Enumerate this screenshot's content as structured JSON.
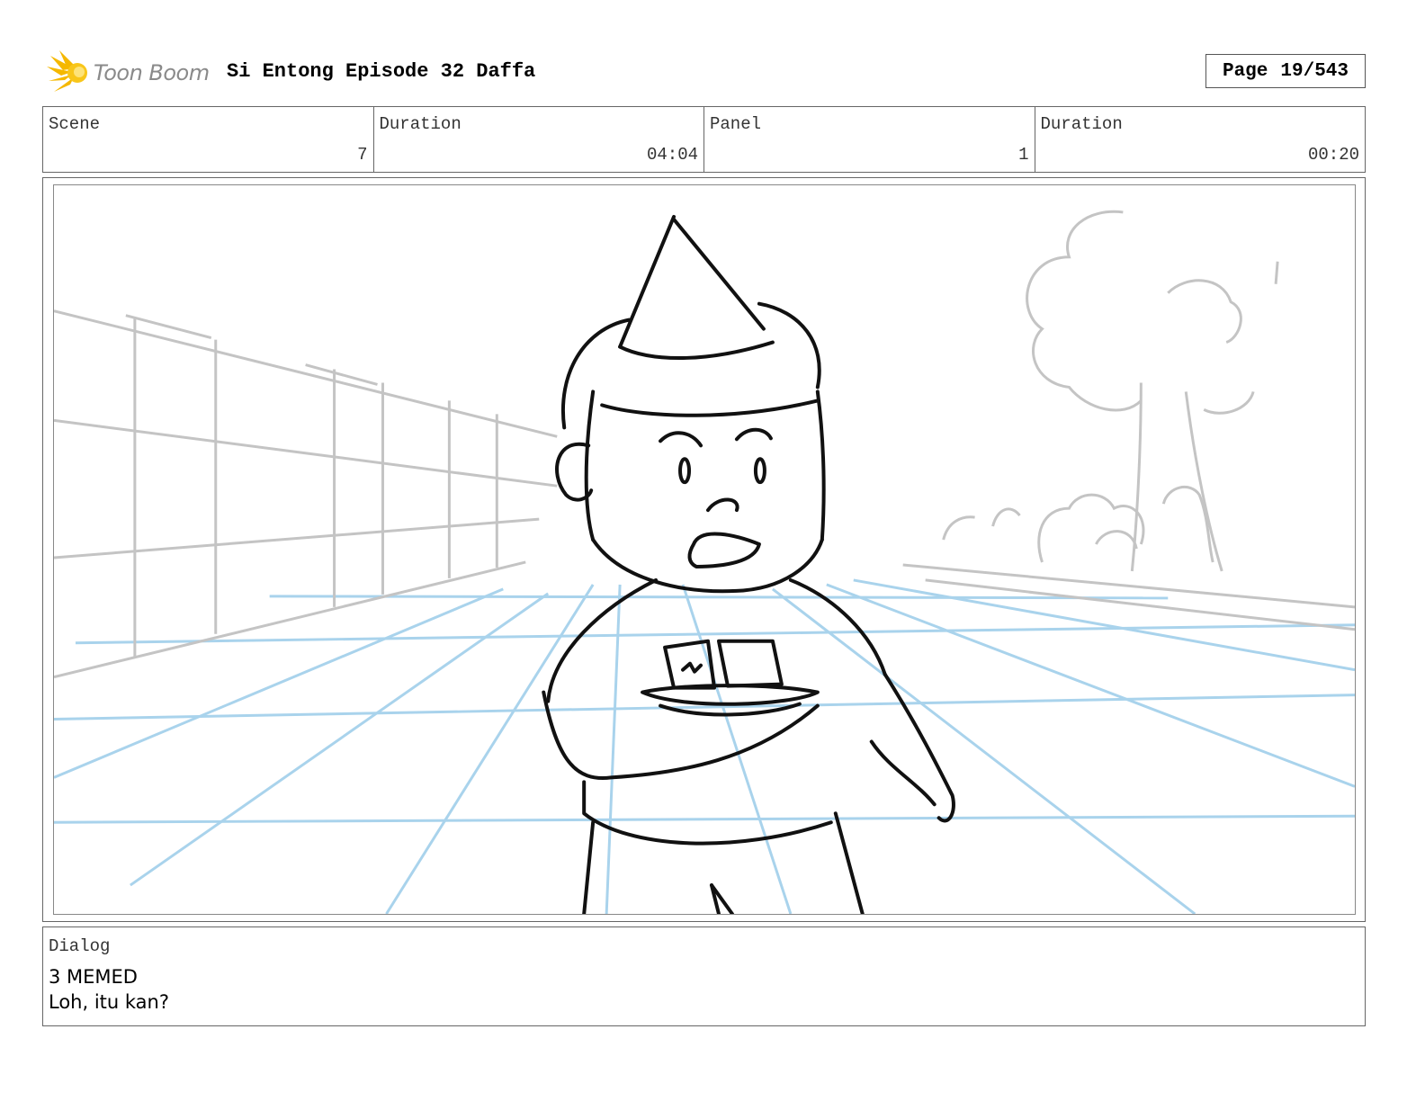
{
  "header": {
    "logo_text": "Toon Boom",
    "project_title": "Si Entong Episode 32 Daffa",
    "page_label": "Page",
    "page_value": "19/543"
  },
  "info": {
    "scene_label": "Scene",
    "scene_value": "7",
    "scene_duration_label": "Duration",
    "scene_duration_value": "04:04",
    "panel_label": "Panel",
    "panel_value": "1",
    "panel_duration_label": "Duration",
    "panel_duration_value": "00:20"
  },
  "dialog": {
    "label": "Dialog",
    "lines": [
      "3 MEMED",
      "Loh, itu kan?"
    ]
  },
  "colors": {
    "logo_accent": "#f5b800",
    "sketch_line": "#111111",
    "background_sketch": "#c4c4c4",
    "perspective_grid": "#a9d3ec"
  },
  "icons": [
    "toon-boom-logo-icon"
  ]
}
